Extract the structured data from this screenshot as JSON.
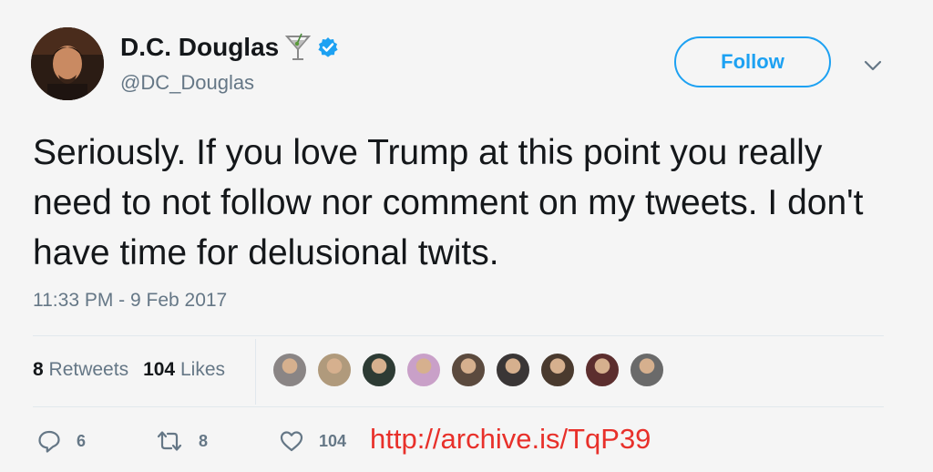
{
  "author": {
    "name": "D.C. Douglas",
    "handle": "@DC_Douglas",
    "verified": true,
    "name_emoji": "martini-glass-icon"
  },
  "follow_label": "Follow",
  "tweet_text": "Seriously. If you love Trump at this point you really need to not follow nor comment on my tweets. I don't have time for delusional twits.",
  "timestamp": "11:33 PM - 9 Feb 2017",
  "stats": {
    "retweets_count": "8",
    "retweets_label": "Retweets",
    "likes_count": "104",
    "likes_label": "Likes"
  },
  "liker_avatars": [
    "#8a8585",
    "#b09a7c",
    "#2d3b34",
    "#c9a0c8",
    "#5b4a3e",
    "#3a3636",
    "#4a3a2e",
    "#5c2e2e",
    "#6a6a6a"
  ],
  "actions": {
    "reply_count": "6",
    "retweet_count": "8",
    "like_count": "104"
  },
  "archive_link": "http://archive.is/TqP39",
  "colors": {
    "accent": "#1da1f2",
    "muted": "#657786",
    "link_overlay": "#e8302a",
    "background": "#f5f5f5"
  }
}
